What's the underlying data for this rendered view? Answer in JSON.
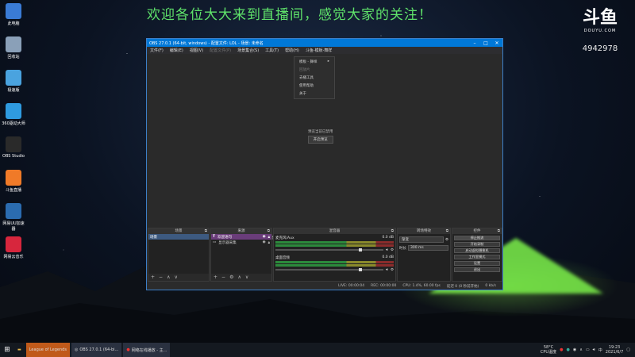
{
  "overlay": {
    "banner": "欢迎各位大大来到直播间，感觉大家的关注！",
    "logo_main": "斗鱼",
    "logo_sub": "DOUYU.COM",
    "room_number": "4942978"
  },
  "desktop_icons": [
    {
      "label": "此电脑",
      "icon": "computer-icon",
      "color": "#3a7bd5"
    },
    {
      "label": "回收站",
      "icon": "recycle-bin-icon",
      "color": "#8aa0b8"
    },
    {
      "label": "极速版",
      "icon": "app-icon",
      "color": "#4aa3df"
    },
    {
      "label": "360驱动大师",
      "icon": "driver-icon",
      "color": "#2f9be0"
    },
    {
      "label": "OBS Studio",
      "icon": "obs-icon",
      "color": "#2a2a2a"
    },
    {
      "label": "斗鱼直播",
      "icon": "douyu-icon",
      "color": "#f07a28"
    },
    {
      "label": "网易UU加速器",
      "icon": "uu-icon",
      "color": "#2b6cb0"
    },
    {
      "label": "网易云音乐",
      "icon": "music-icon",
      "color": "#d7263d"
    }
  ],
  "obs": {
    "title": "OBS 27.0.1 (64-bit, windows) - 配置文件: LOL - 场景: 未命名",
    "menu": [
      "文件(F)",
      "编辑(E)",
      "视图(V)",
      "配置文件(P)",
      "场景集合(S)",
      "工具(T)",
      "帮助(H)",
      "斗鱼-模板-舞样"
    ],
    "dropdown": {
      "items": [
        "模板 - 舞样",
        "回放片",
        "去播工具",
        "使用帮助",
        "关于"
      ],
      "submenu_marker": "▸"
    },
    "preview": {
      "message": "预览当前已禁用",
      "button": "开启预览"
    },
    "scene_bar": {
      "left": "未选择源",
      "props": "属性",
      "filters": "滤镜"
    },
    "docks": {
      "scenes": {
        "title": "场景",
        "items": [
          "场景"
        ]
      },
      "sources": {
        "title": "来源",
        "items": [
          "欢迎语句",
          "显示器采集"
        ]
      },
      "mixer": {
        "title": "混音器",
        "channels": [
          {
            "name": "麦克风/Aux",
            "db": "0.0 dB"
          },
          {
            "name": "桌面音频",
            "db": "0.0 dB"
          }
        ]
      },
      "transitions": {
        "title": "转场特效",
        "type": "渐变",
        "duration_label": "时长",
        "duration": "300 ms"
      },
      "controls": {
        "title": "控件",
        "buttons": [
          "停止推流",
          "开始录制",
          "启动虚拟摄像机",
          "工作室模式",
          "设置",
          "退出"
        ]
      }
    },
    "status": {
      "live": "LIVE: 00:00:04",
      "rec": "REC: 00:00:00",
      "cpu": "CPU: 1.4%, 60.00 fps",
      "dropped": "延迟 0 (0 秒前开始)",
      "kbps": "0 kb/s"
    }
  },
  "taskbar": {
    "items": [
      {
        "label": "League of Legends",
        "active": true
      },
      {
        "label": "OBS 27.0.1 (64-bi...",
        "active": false
      },
      {
        "label": "网络在线播放 - 主...",
        "active": false
      }
    ],
    "temp": "58°C",
    "temp_label": "CPU温度",
    "time": "19:23",
    "date": "2021/6/7",
    "lang": "中"
  }
}
